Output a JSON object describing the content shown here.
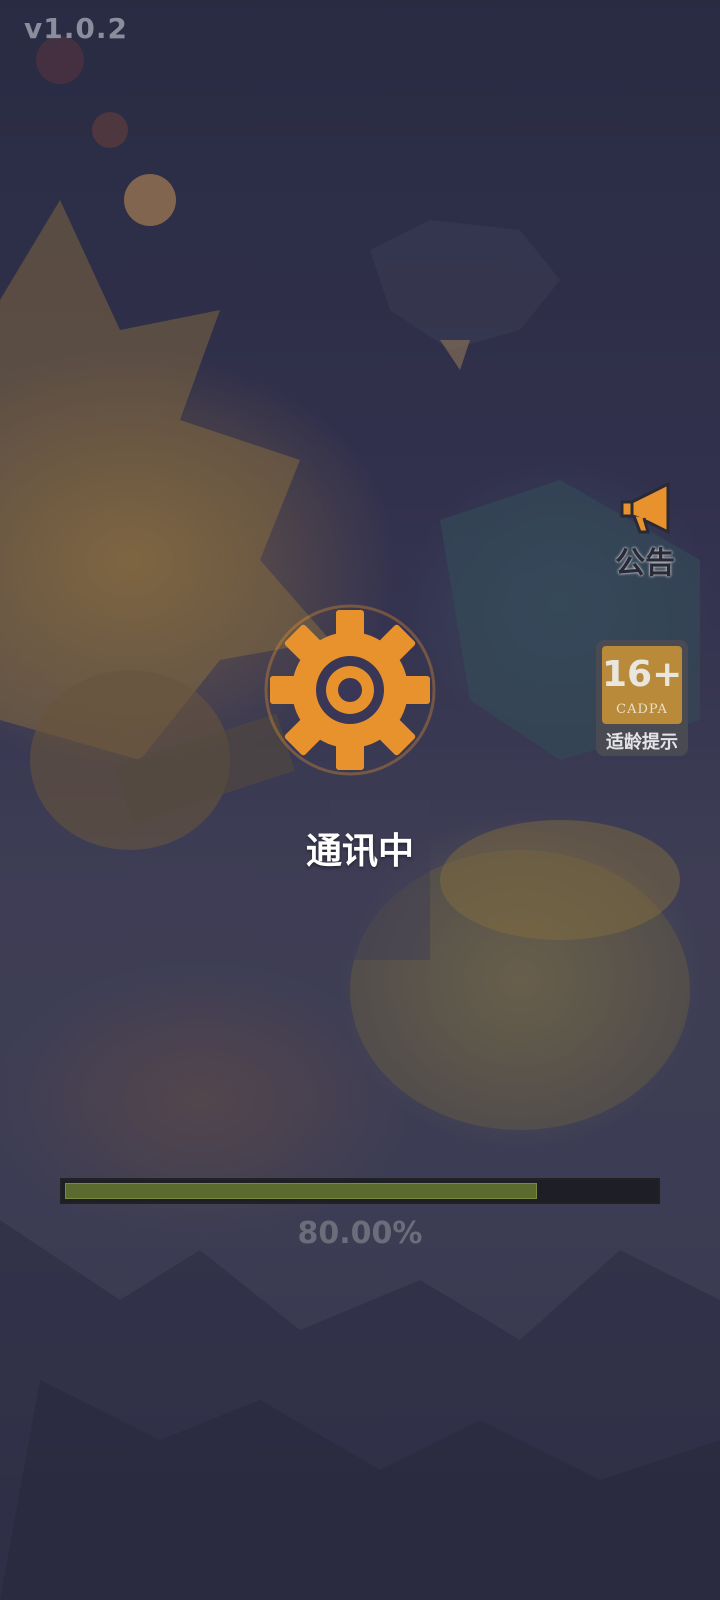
{
  "app": {
    "version": "v1.0.2"
  },
  "notice": {
    "label": "公告",
    "icon": "megaphone-icon"
  },
  "age_rating": {
    "rating": "16+",
    "org": "CADPA",
    "caption": "适龄提示"
  },
  "loading": {
    "status": "通讯中",
    "icon": "gear-icon",
    "progress": 0.8,
    "progress_text": "80.00%"
  },
  "colors": {
    "gear": "#e8922e",
    "progress_fill": "#5b6b30",
    "progress_track": "#1e1e26",
    "badge": "#b88a3a"
  }
}
